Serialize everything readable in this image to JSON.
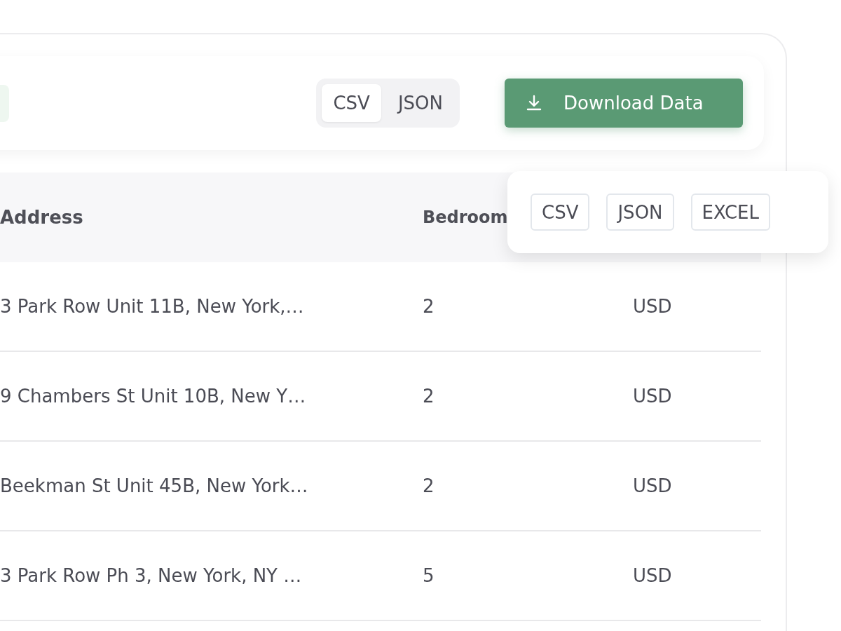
{
  "toolbar": {
    "format_toggle": [
      {
        "label": "CSV",
        "selected": true
      },
      {
        "label": "JSON",
        "selected": false
      }
    ],
    "download_button": {
      "label": "Download Data"
    }
  },
  "table": {
    "columns": [
      "Address",
      "Bedroom"
    ],
    "rows": [
      {
        "address": "3 Park Row Unit 11B, New York,…",
        "bedrooms": "2",
        "currency": "USD"
      },
      {
        "address": "9 Chambers St Unit 10B, New Y…",
        "bedrooms": "2",
        "currency": "USD"
      },
      {
        "address": "Beekman St Unit 45B, New York…",
        "bedrooms": "2",
        "currency": "USD"
      },
      {
        "address": "3 Park Row Ph 3, New York, NY …",
        "bedrooms": "5",
        "currency": "USD"
      }
    ]
  },
  "download_menu": {
    "options": [
      "CSV",
      "JSON",
      "EXCEL"
    ]
  }
}
